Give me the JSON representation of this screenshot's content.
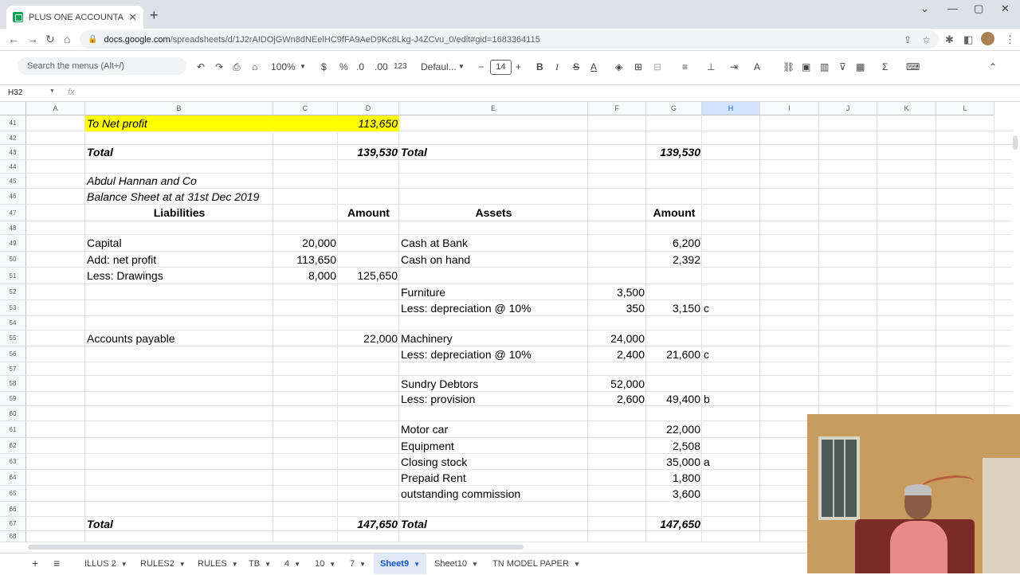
{
  "browser": {
    "tab_title": "PLUS ONE ACCOUNTANCY TAMI",
    "url_host": "docs.google.com",
    "url_path": "/spreadsheets/d/1J2rAIDOjGWn8dNEelHC9fFA9AeD9Kc8Lkg-J4ZCvu_0/edit#gid=1683364115"
  },
  "toolbar": {
    "search_placeholder": "Search the menus (Alt+/)",
    "zoom": "100%",
    "currency": "$",
    "percent": "%",
    "dec_less": ".0",
    "dec_more": ".00",
    "format_123": "123",
    "font": "Defaul...",
    "font_size": "14"
  },
  "formula_bar": {
    "cell_ref": "H32",
    "fx": "fx"
  },
  "columns": [
    "A",
    "B",
    "C",
    "D",
    "E",
    "F",
    "G",
    "H",
    "I",
    "J",
    "K",
    "L"
  ],
  "rows": [
    "41",
    "42",
    "43",
    "44",
    "45",
    "46",
    "47",
    "48",
    "49",
    "50",
    "51",
    "52",
    "53",
    "54",
    "55",
    "56",
    "57",
    "58",
    "59",
    "60",
    "61",
    "62",
    "63",
    "64",
    "65",
    "66",
    "67",
    "68"
  ],
  "cells": {
    "r41": {
      "b": "To Net profit",
      "d": "113,650"
    },
    "r43": {
      "b": "Total",
      "d": "139,530",
      "e": "Total",
      "g": "139,530"
    },
    "r45": {
      "b": "Abdul Hannan and Co"
    },
    "r46": {
      "b": "Balance Sheet at at 31st Dec 2019"
    },
    "r47": {
      "b": "Liabilities",
      "d": "Amount",
      "e": "Assets",
      "g": "Amount"
    },
    "r49": {
      "b": "Capital",
      "c": "20,000",
      "e": "Cash at Bank",
      "g": "6,200"
    },
    "r50": {
      "b": "Add: net profit",
      "c": "113,650",
      "e": "Cash on hand",
      "g": "2,392"
    },
    "r51": {
      "b": "Less: Drawings",
      "c": "8,000",
      "d": "125,650"
    },
    "r52": {
      "e": "Furniture",
      "f": "3,500"
    },
    "r53": {
      "e": "Less: depreciation @ 10%",
      "f": "350",
      "g": "3,150",
      "h": "c"
    },
    "r55": {
      "b": "Accounts payable",
      "d": "22,000",
      "e": "Machinery",
      "f": "24,000"
    },
    "r56": {
      "e": "Less: depreciation @ 10%",
      "f": "2,400",
      "g": "21,600",
      "h": "c"
    },
    "r58": {
      "e": "Sundry Debtors",
      "f": "52,000"
    },
    "r59": {
      "e": "Less: provision",
      "f": "2,600",
      "g": "49,400",
      "h": "b"
    },
    "r61": {
      "e": "Motor car",
      "g": "22,000"
    },
    "r62": {
      "e": "Equipment",
      "g": "2,508"
    },
    "r63": {
      "e": "Closing stock",
      "g": "35,000",
      "h": "a"
    },
    "r64": {
      "e": "Prepaid Rent",
      "g": "1,800"
    },
    "r65": {
      "e": "outstanding commission",
      "g": "3,600"
    },
    "r67": {
      "b": "Total",
      "d": "147,650",
      "e": "Total",
      "g": "147,650"
    }
  },
  "sheet_tabs": [
    "ILLUS 2",
    "RULES2",
    "RULES",
    "TB",
    "4",
    "10",
    "7",
    "Sheet9",
    "Sheet10",
    "TN MODEL PAPER"
  ],
  "active_sheet": "Sheet9",
  "colors": {
    "highlight": "#ffff00",
    "active_tab_text": "#0b57d0",
    "sheets_icon": "#0f9d58"
  }
}
